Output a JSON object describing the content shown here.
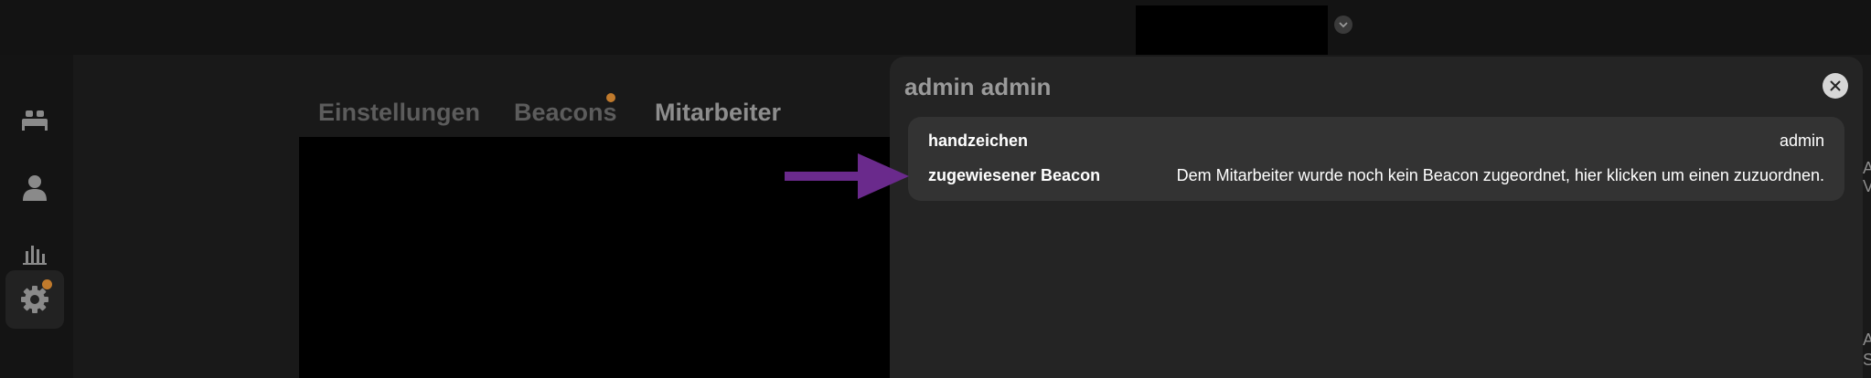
{
  "sidebar": {
    "items": [
      {
        "icon": "bed-icon",
        "active": false
      },
      {
        "icon": "user-icon",
        "active": false
      },
      {
        "icon": "bar-chart-icon",
        "active": false
      },
      {
        "icon": "gear-icon",
        "active": true,
        "badge": true
      }
    ]
  },
  "tabs": [
    {
      "label": "Einstellungen",
      "active": false
    },
    {
      "label": "Beacons",
      "active": false,
      "badge": true
    },
    {
      "label": "Mitarbeiter",
      "active": true
    }
  ],
  "panel": {
    "title": "admin admin",
    "rows": [
      {
        "label": "handzeichen",
        "value": "admin"
      },
      {
        "label": "zugewiesener Beacon",
        "value": "Dem Mitarbeiter wurde noch kein Beacon zugeordnet, hier klicken um einen zuzuordnen."
      }
    ]
  },
  "edge_text": [
    "A",
    "V",
    "A",
    "S"
  ],
  "colors": {
    "badge": "#c07a2c",
    "arrow": "#6a2a8c",
    "panel_bg": "#242424",
    "card_bg": "#333333"
  }
}
